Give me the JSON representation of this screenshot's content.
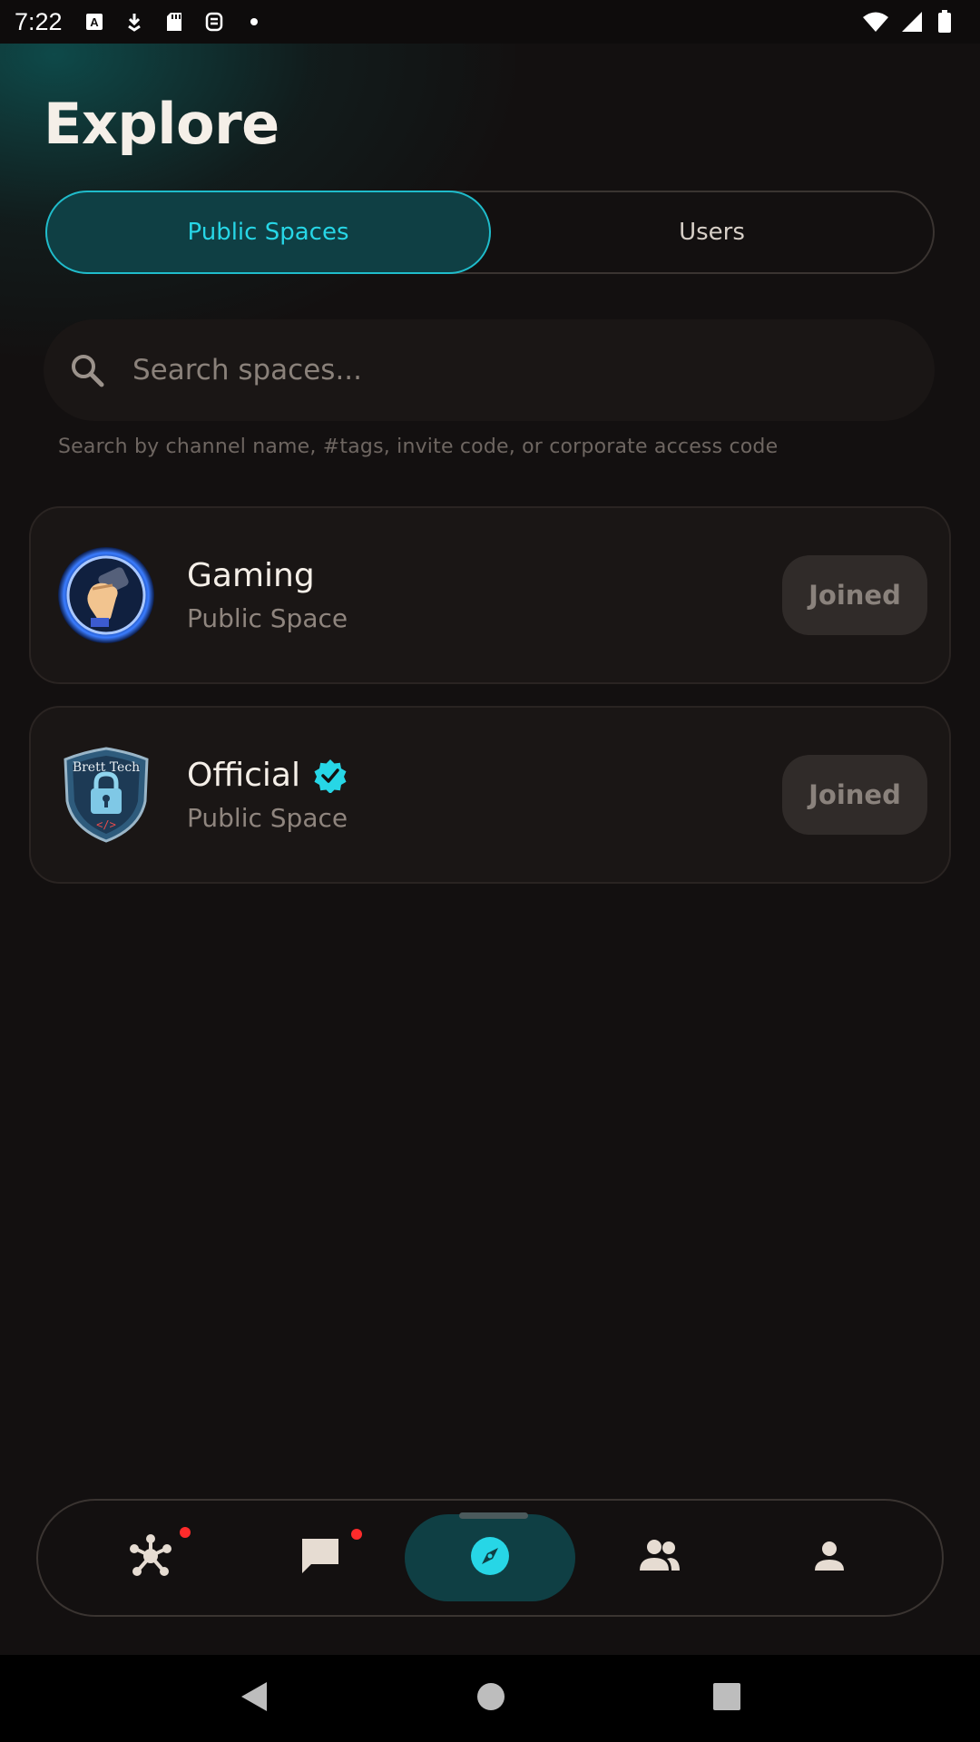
{
  "status_bar": {
    "time": "7:22"
  },
  "page": {
    "title": "Explore"
  },
  "tabs": [
    {
      "label": "Public Spaces",
      "active": true
    },
    {
      "label": "Users",
      "active": false
    }
  ],
  "search": {
    "placeholder": "Search spaces...",
    "value": "",
    "hint": "Search by channel name, #tags, invite code, or corporate access code"
  },
  "spaces": [
    {
      "name": "Gaming",
      "subtitle": "Public Space",
      "verified": false,
      "action": "Joined"
    },
    {
      "name": "Official",
      "subtitle": "Public Space",
      "verified": true,
      "action": "Joined",
      "avatar_text": "Brett Tech"
    }
  ],
  "bottom_nav": {
    "items": [
      {
        "icon": "network-icon",
        "badge": true
      },
      {
        "icon": "chat-icon",
        "badge": true
      },
      {
        "icon": "compass-icon",
        "active": true
      },
      {
        "icon": "people-icon"
      },
      {
        "icon": "profile-icon"
      }
    ]
  },
  "colors": {
    "accent": "#27d6e6",
    "active_bg": "#0f3f44",
    "background": "#131010",
    "badge": "#ff2b2b"
  }
}
